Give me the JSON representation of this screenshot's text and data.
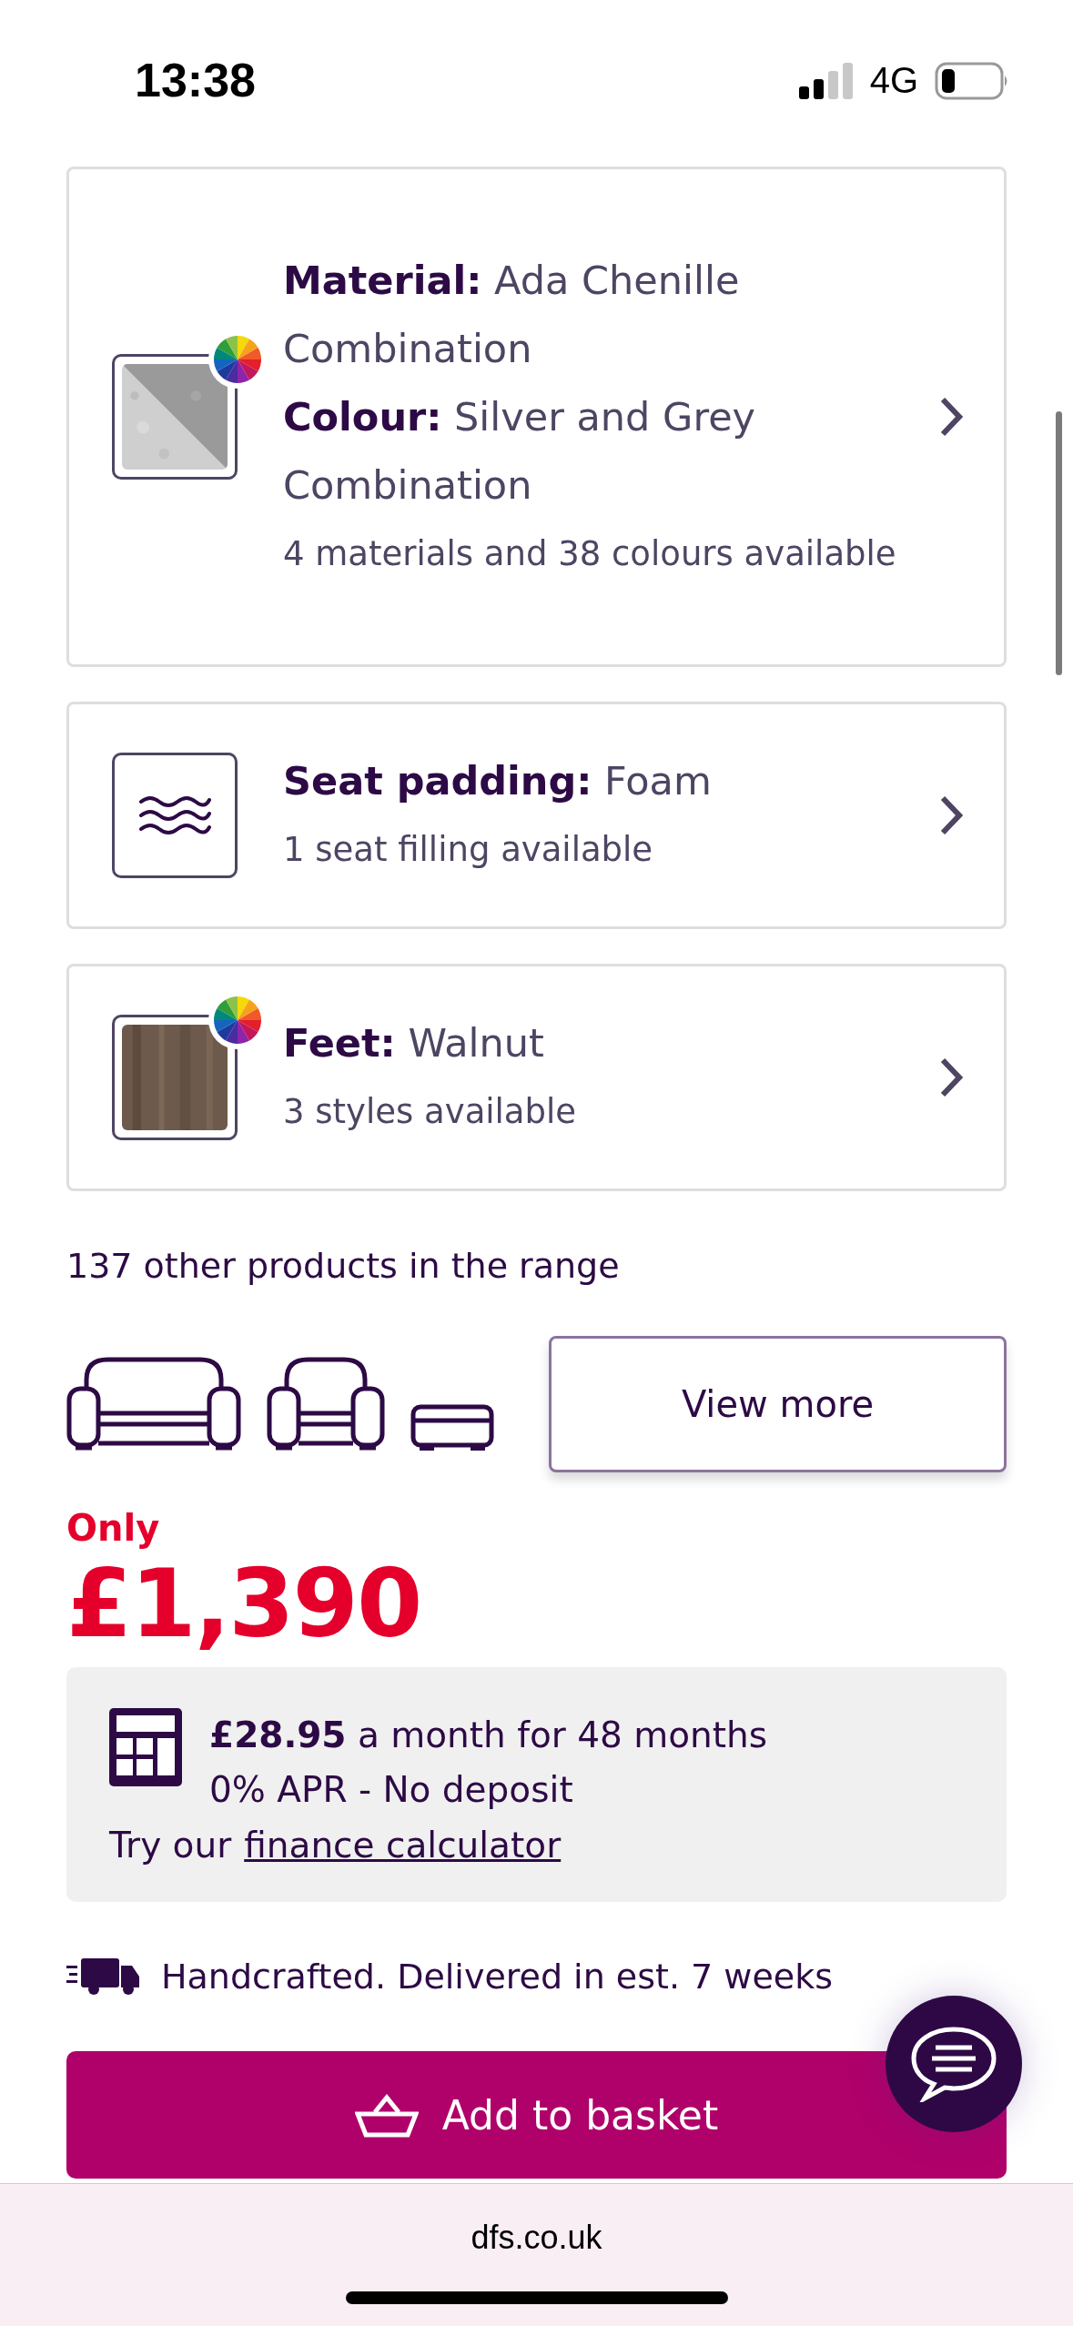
{
  "status_bar": {
    "time": "13:38",
    "network": "4G"
  },
  "options": [
    {
      "kind": "fabric",
      "lines": [
        "**Material:** Ada Chenille Combination",
        "**Colour:** Silver and Grey Combination"
      ],
      "detail": "4 materials and 38 colours available"
    },
    {
      "kind": "padding",
      "lines": [
        "**Seat padding:** Foam"
      ],
      "detail": "1 seat filling available"
    },
    {
      "kind": "wood",
      "lines": [
        "**Feet:** Walnut"
      ],
      "detail": "3 styles available"
    }
  ],
  "range": {
    "label": "137 other products in the range",
    "button": "View more"
  },
  "price": {
    "prefix": "Only",
    "amount": "£1,390"
  },
  "finance": {
    "line_1": "**£28.95** a month for 48 months",
    "line_2": "0% APR - No deposit",
    "prompt": "Try our",
    "link": "finance calculator"
  },
  "delivery": "Handcrafted. Delivered in est. 7 weeks",
  "basket_button": "Add to basket",
  "browser": {
    "url": "dfs.co.uk"
  }
}
